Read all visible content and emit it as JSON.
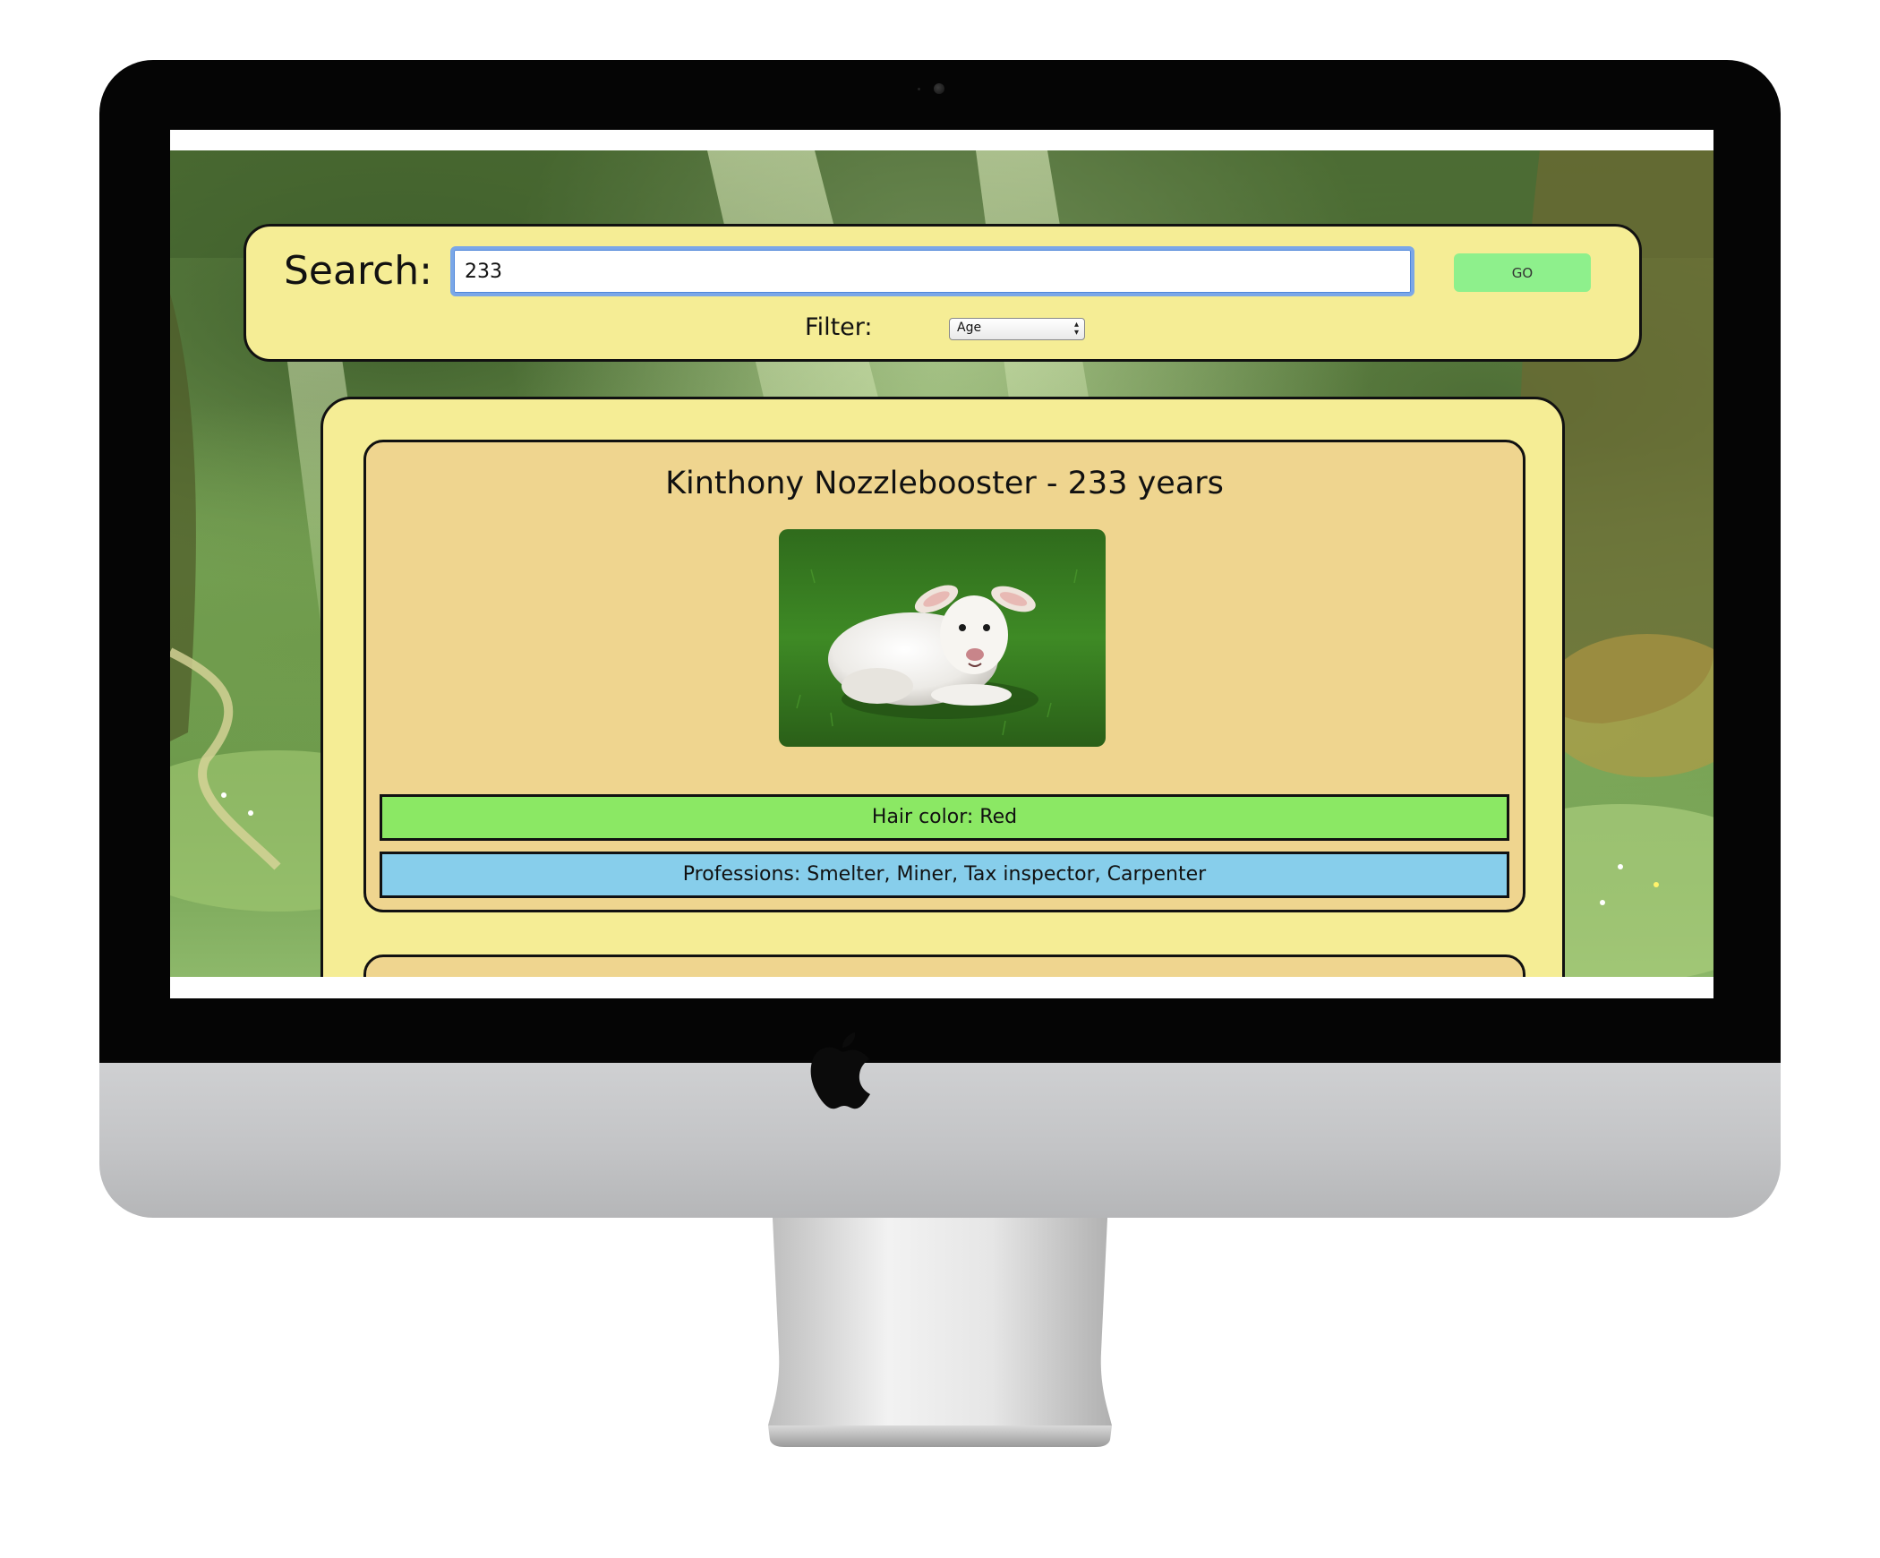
{
  "search": {
    "label": "Search:",
    "query": "233",
    "go_label": "GO"
  },
  "filter": {
    "label": "Filter:",
    "selected": "Age"
  },
  "results": [
    {
      "title": "Kinthony Nozzlebooster - 233 years",
      "hair": "Hair color: Red",
      "professions": "Professions: Smelter, Miner, Tax inspector, Carpenter"
    }
  ],
  "colors": {
    "panel": "#f5ed95",
    "card": "#efd58f",
    "hair_badge": "#8be864",
    "professions_badge": "#87ceeb",
    "go_button": "#8ef08c"
  }
}
